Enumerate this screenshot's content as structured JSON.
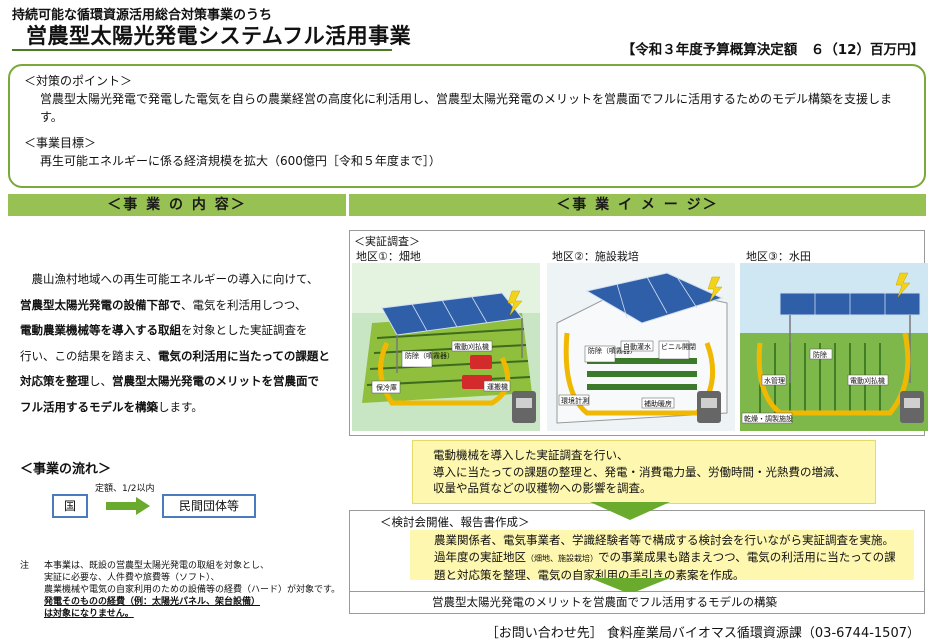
{
  "header": {
    "pre_title": "持続可能な循環資源活用総合対策事業のうち",
    "title": "営農型太陽光発電システムフル活用事業",
    "budget": "【令和３年度予算概算決定額　６（12）百万円】"
  },
  "policy": {
    "point_heading": "＜対策のポイント＞",
    "point_text": "営農型太陽光発電で発電した電気を自らの農業経営の高度化に利活用し、営農型太陽光発電のメリットを営農面でフルに活用するためのモデル構築を支援します。",
    "goal_heading": "＜事業目標＞",
    "goal_text": "再生可能エネルギーに係る経済規模を拡大（600億円［令和５年度まで］）"
  },
  "sections": {
    "content_header": "＜事 業 の 内 容＞",
    "image_header": "＜事 業 イ メ ー ジ＞"
  },
  "content": {
    "p1": "農山漁村地域への再生可能エネルギーの導入に向けて、",
    "p2_bold": "営農型太陽光発電の設備下部で",
    "p2_rest": "、電気を利活用しつつ、",
    "p3_bold": "電動農業機械等を導入する取組",
    "p3_rest": "を対象とした実証調査を",
    "p4_a": "行い、この結果を踏まえ、",
    "p4_bold": "電気の利活用に当たっての課題と",
    "p5_bold": "対応策を整理",
    "p5_a": "し、",
    "p5_bold2": "営農型太陽光発電のメリットを営農面で",
    "p6_bold": "フル活用するモデルを構築",
    "p6_rest": "します。"
  },
  "flow": {
    "heading": "＜事業の流れ＞",
    "note": "定額、1/2以内",
    "from": "国",
    "to": "民間団体等"
  },
  "notes": {
    "mark": "注",
    "line1": "本事業は、既設の営農型太陽光発電の取組を対象とし、",
    "line2": "実証に必要な、人件費や旅費等（ソフト）、",
    "line3": "農業機械や電気の自家利用のための設備等の経費（ハード）が対象です。",
    "line4": "発電そのものの経費（例：太陽光パネル、架台設備）",
    "line5": "は対象になりません。"
  },
  "image": {
    "survey_label": "＜実証調査＞",
    "regions": [
      {
        "label": "地区①：畑地"
      },
      {
        "label": "地区②：施設栽培"
      },
      {
        "label": "地区③：水田"
      }
    ],
    "scene1_labels": [
      "防除（噴霧器）",
      "電動刈払機",
      "保冷庫",
      "運搬機"
    ],
    "scene2_labels": [
      "防除（噴霧器）",
      "自動灌水",
      "ビニル開閉",
      "環境計測",
      "補助暖房"
    ],
    "scene3_labels": [
      "防除",
      "水管理",
      "電動刈払機",
      "乾燥・調製施設"
    ]
  },
  "survey_box": {
    "l1": "電動機械を導入した実証調査を行い、",
    "l2": "導入に当たっての課題の整理と、発電・消費電力量、労働時間・光熱費の増減、",
    "l3": "収量や品質などの収穫物への影響を調査。"
  },
  "meeting": {
    "title": "＜検討会開催、報告書作成＞",
    "l1": "農業関係者、電気事業者、学識経験者等で構成する検討会を行いながら実証調査を実施。",
    "l2_a": "過年度の実証地区",
    "l2_small": "（畑地、施設栽培）",
    "l2_b": "での事業成果も踏まえつつ、電気の利活用に当たっての課",
    "l3": "題と対応策を整理、電気の自家利用の手引きの素案を作成。"
  },
  "final": {
    "text": "営農型太陽光発電のメリットを営農面でフル活用するモデルの構築"
  },
  "contact": {
    "text": "［お問い合わせ先］ 食料産業局バイオマス循環資源課（03-6744-1507）"
  },
  "colors": {
    "header_green": "#97c152",
    "border_green": "#7aa83a",
    "yellow_bg": "#fef7b0",
    "flow_blue": "#4a7bbf"
  }
}
